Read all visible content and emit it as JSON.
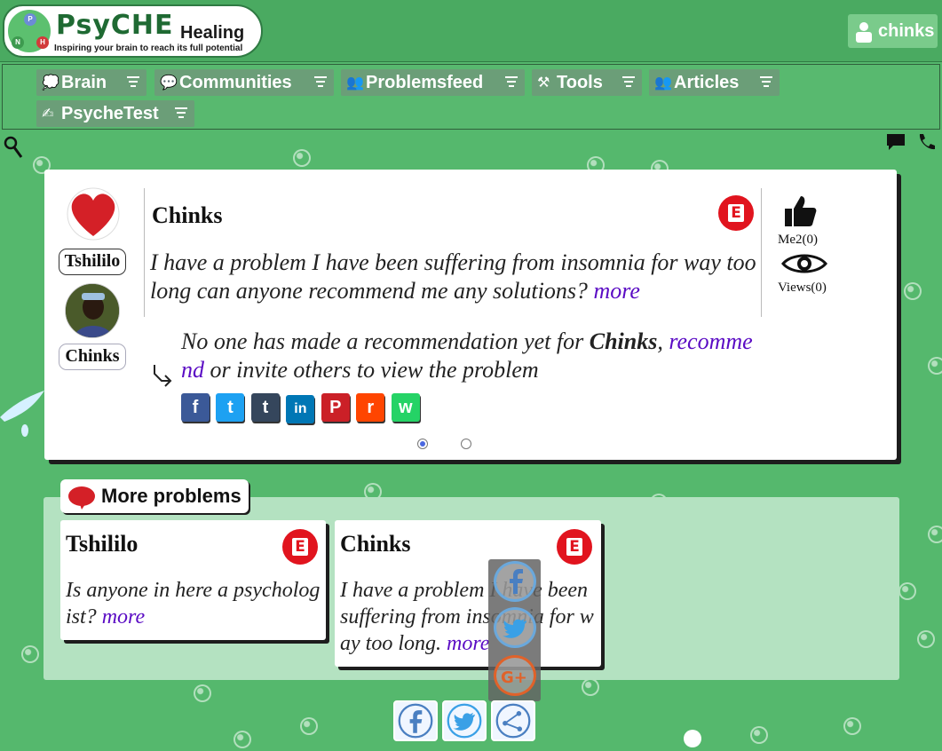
{
  "header": {
    "logo_title_part1": "PsyCHE",
    "logo_title_part2": "Healing",
    "logo_tagline": "Inspiring your brain to reach its full potential",
    "logo_letters": [
      "P",
      "N",
      "H"
    ],
    "user_name": "chinks"
  },
  "nav": {
    "items": [
      {
        "label": "Brain",
        "icon": "brain-icon"
      },
      {
        "label": "Communities",
        "icon": "chat-bubble-icon"
      },
      {
        "label": "Problemsfeed",
        "icon": "people-icon"
      },
      {
        "label": "Tools",
        "icon": "tools-icon"
      },
      {
        "label": "Articles",
        "icon": "people-icon"
      },
      {
        "label": "PsycheTest",
        "icon": "pen-icon"
      }
    ]
  },
  "problem": {
    "poster_name": "Tshililo",
    "author_name": "Chinks",
    "title": "Chinks",
    "text": "I have a problem I have been suffering from insomnia for way too long can anyone recommend me any solutions?",
    "more_label": "more",
    "me2_label": "Me2(0)",
    "views_label": "Views(0)",
    "reco_prefix": "No one has made a recommendation yet for",
    "reco_name": "Chinks",
    "reco_comma": ",",
    "reco_link": "recommend",
    "reco_suffix": "or invite others to view the problem",
    "badge_letter": "E",
    "share": [
      {
        "label": "f",
        "color": "#3b5998"
      },
      {
        "label": "t",
        "color": "#1da1f2"
      },
      {
        "label": "t",
        "color": "#35465c"
      },
      {
        "label": "in",
        "color": "#0077b5"
      },
      {
        "label": "P",
        "color": "#cb2027"
      },
      {
        "label": "r",
        "color": "#ff4500"
      },
      {
        "label": "w",
        "color": "#25d366"
      }
    ]
  },
  "more_problems": {
    "heading": "More problems",
    "cards": [
      {
        "title": "Tshililo",
        "text": "Is anyone in here a psychologist?",
        "more": "more"
      },
      {
        "title": "Chinks",
        "text": "I have a problem I have been suffering from insomnia for way too long.",
        "more": "more"
      }
    ]
  },
  "colors": {
    "background": "#55b86d",
    "accent_red": "#e1141e",
    "link_purple": "#5a0bc4"
  }
}
